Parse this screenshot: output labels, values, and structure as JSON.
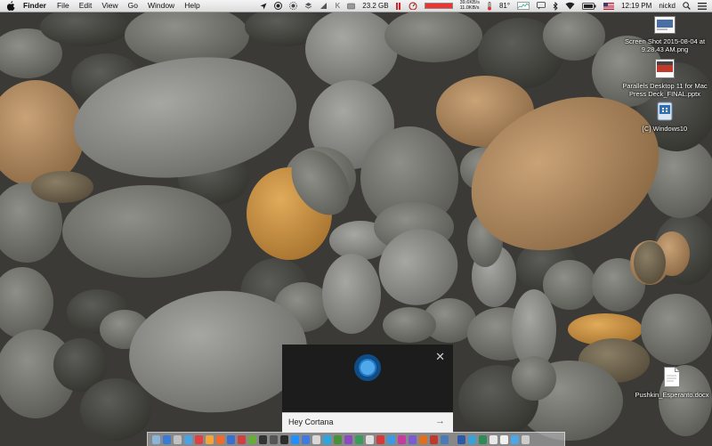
{
  "menubar": {
    "app_name": "Finder",
    "menus": [
      "File",
      "Edit",
      "View",
      "Go",
      "Window",
      "Help"
    ],
    "status": {
      "disk_free": "23.2 GB",
      "net_up": "39.6KB/s",
      "net_down": "11.0KB/s",
      "temperature": "81°",
      "clock": "12:19 PM",
      "user": "nickd",
      "k_label": "K"
    }
  },
  "desktop_icons": [
    {
      "label": "Screen Shot 2015-08-04 at 9.28.43 AM.png",
      "kind": "screenshot-file-icon"
    },
    {
      "label": "Parallels Desktop 11 for Mac Press Deck_FINAL.pptx",
      "kind": "pptx-file-icon"
    },
    {
      "label": "[C] Windows10",
      "kind": "drive-icon"
    },
    {
      "label": "Pushkin_Esperanto.docx",
      "kind": "docx-file-icon"
    }
  ],
  "cortana": {
    "prompt": "Hey Cortana",
    "close_glyph": "✕",
    "arrow_glyph": "→"
  },
  "dock": {
    "icon_colors": [
      "#8ab4d8",
      "#3a7bd5",
      "#c0c0c0",
      "#4aa3e0",
      "#e04040",
      "#f2a33a",
      "#f06a2a",
      "#3a6fcf",
      "#d04040",
      "#6aaa3a",
      "#333333",
      "#555555",
      "#2c2c2c",
      "#1e90ff",
      "#3d7be0",
      "#d8d8d8",
      "#2ca6e0",
      "#4a8f3a",
      "#8a4bbf",
      "#3a9c5a",
      "#e0e0e0",
      "#d43a3a",
      "#3b9ae1",
      "#c83aa0",
      "#7a5bd0",
      "#e07020",
      "#c0392b",
      "#4a7ab8",
      "#2b5aa8",
      "#3aa0d8",
      "#2e8b57",
      "#e8e8e8",
      "#f0f0f0",
      "#4aa8e8",
      "#cccccc"
    ]
  },
  "colors": {
    "cortana_blue": "#2478c4",
    "menubar_bg": "#e8e8e8"
  }
}
